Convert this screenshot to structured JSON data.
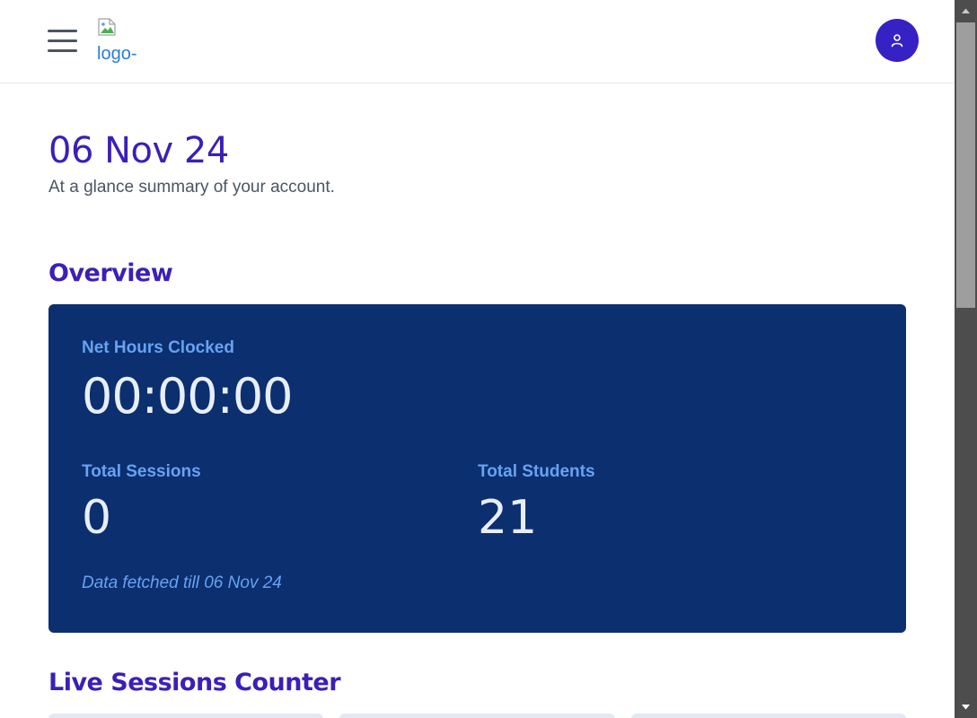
{
  "header": {
    "logo_alt": "logo-",
    "menu_icon": "hamburger-icon",
    "avatar_icon": "user-icon",
    "colors": {
      "avatar": "#3521c4"
    }
  },
  "page": {
    "date_title": "06 Nov 24",
    "subtitle": "At a glance summary of your account."
  },
  "overview": {
    "heading": "Overview",
    "net_hours_label": "Net Hours Clocked",
    "net_hours_value": "00:00:00",
    "total_sessions_label": "Total Sessions",
    "total_sessions_value": "0",
    "total_students_label": "Total Students",
    "total_students_value": "21",
    "fetched_note": "Data fetched till 06 Nov 24",
    "colors": {
      "card_bg": "#0b2f6f",
      "label": "#66a3f2",
      "value": "#e8eef8"
    }
  },
  "live_sessions": {
    "heading": "Live Sessions Counter"
  },
  "theme": {
    "accent": "#3b1fb8"
  }
}
